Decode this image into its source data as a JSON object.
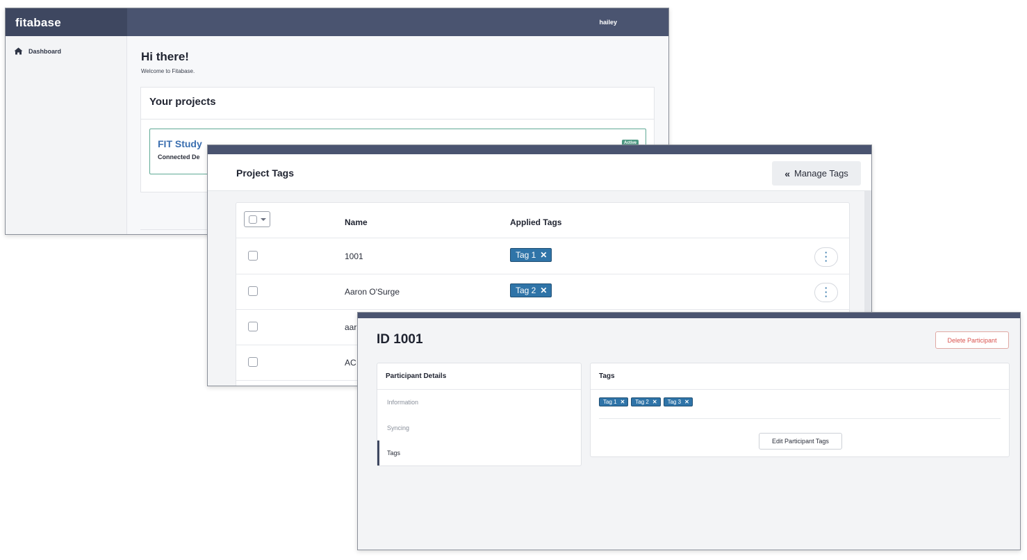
{
  "dashboard": {
    "brand": "fitabase",
    "user": "hailey",
    "sidebar": {
      "dashboard_label": "Dashboard"
    },
    "greeting": "Hi there!",
    "welcome": "Welcome to Fitabase.",
    "projects_title": "Your projects",
    "project": {
      "name": "FIT Study",
      "subtitle": "Connected De",
      "status": "Active"
    },
    "icons": {
      "home": "home-icon"
    }
  },
  "project_tags": {
    "title": "Project Tags",
    "manage_button": {
      "chevron": "«",
      "label": "Manage Tags"
    },
    "columns": [
      "Name",
      "Applied Tags"
    ],
    "rows": [
      {
        "name": "1001",
        "tag": "Tag 1",
        "remove": "✕"
      },
      {
        "name": "Aaron O'Surge",
        "tag": "Tag 2",
        "remove": "✕"
      },
      {
        "name": "aar"
      },
      {
        "name": "AC"
      }
    ],
    "icons": {
      "row_menu": "kebab-icon",
      "select_all_caret": "caret-down-icon"
    }
  },
  "participant": {
    "id_title": "ID 1001",
    "delete_button": "Delete Participant",
    "details_title": "Participant Details",
    "menu": [
      "Information",
      "Syncing",
      "Tags"
    ],
    "active_menu": "Tags",
    "tags_title": "Tags",
    "tags": [
      {
        "label": "Tag 1",
        "remove": "✕"
      },
      {
        "label": "Tag 2",
        "remove": "✕"
      },
      {
        "label": "Tag 3",
        "remove": "✕"
      }
    ],
    "edit_button": "Edit Participant Tags"
  },
  "colors": {
    "navbar": "#4a5470",
    "tag": "#2f74a8",
    "active_badge": "#4f9a84",
    "link": "#3b6fb0",
    "danger": "#d9534f"
  }
}
